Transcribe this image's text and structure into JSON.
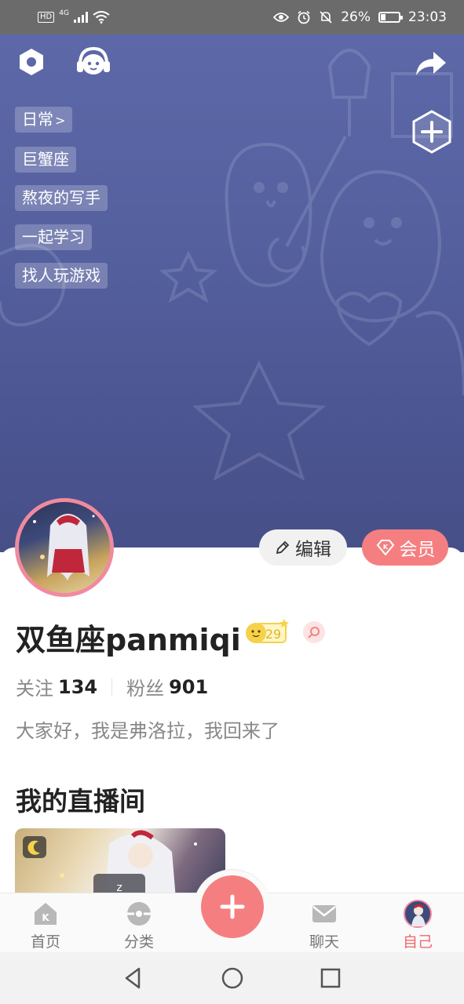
{
  "status_bar": {
    "hd": "HD",
    "net": "4G",
    "battery": "26%",
    "time": "23:03"
  },
  "hero": {
    "tags": [
      "日常",
      "巨蟹座",
      "熬夜的写手",
      "一起学习",
      "找人玩游戏"
    ],
    "first_tag_chevron": ">"
  },
  "profile": {
    "edit_label": "编辑",
    "vip_label": "会员",
    "username": "双鱼座panmiqi",
    "level": "29",
    "following_label": "关注",
    "following_count": "134",
    "followers_label": "粉丝",
    "followers_count": "901",
    "bio": "大家好，我是弗洛拉，我回来了"
  },
  "sections": {
    "live_room_title": "我的直播间"
  },
  "bottom_nav": {
    "items": [
      {
        "label": "首页",
        "icon": "home-icon"
      },
      {
        "label": "分类",
        "icon": "category-icon"
      },
      {
        "label": "聊天",
        "icon": "mail-icon"
      },
      {
        "label": "自己",
        "icon": "avatar"
      }
    ],
    "active": "自己"
  },
  "colors": {
    "accent": "#f57f80",
    "hero": "#55609f",
    "active_tab": "#f06a6f"
  }
}
